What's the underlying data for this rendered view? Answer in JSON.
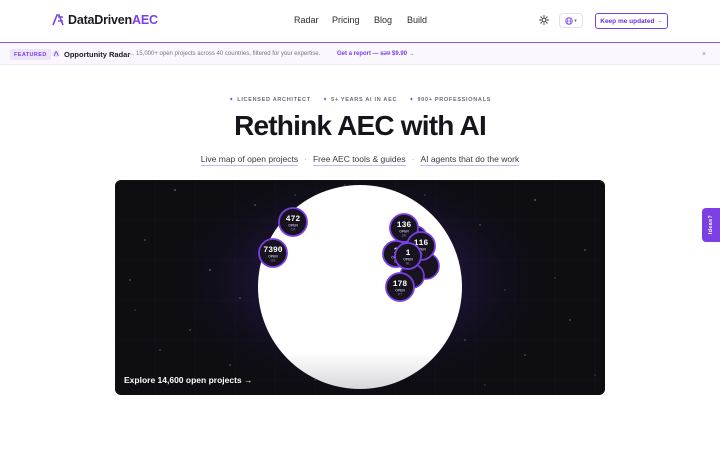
{
  "header": {
    "logo_main": "DataDriven",
    "logo_accent": "AEC",
    "nav": [
      "Radar",
      "Pricing",
      "Blog",
      "Build"
    ],
    "cta_label": "Keep me updated →",
    "theme_icon": "sun-icon",
    "lang_icon": "globe-icon"
  },
  "banner": {
    "tag": "FEATURED",
    "title": "Opportunity Radar",
    "dash": "—",
    "description": "15,000+ open projects across 40 countries, filtered for your expertise.",
    "link_prefix": "Get a report — ",
    "link_old_price": "$29",
    "link_new_price": " $9.90 →",
    "close": "×"
  },
  "hero": {
    "badges": [
      "LICENSED ARCHITECT",
      "5+ YEARS AI IN AEC",
      "900+ PROFESSIONALS"
    ],
    "badge_bullet": "✦",
    "headline": "Rethink AEC with AI",
    "sub_items": [
      "Live map of open projects",
      "Free AEC tools & guides",
      "AI agents that do the work"
    ],
    "sub_sep": "·"
  },
  "map": {
    "explore_label": "Explore 14,600 open projects →",
    "open_label": "OPEN",
    "clusters": [
      {
        "count": "472",
        "code": "CA"
      },
      {
        "count": "7390",
        "code": "US"
      },
      {
        "count": "136",
        "code": "DE"
      },
      {
        "count": "116",
        "code": "PL"
      },
      {
        "count": "1",
        "code": "BE"
      },
      {
        "count": "1",
        "code": "NL"
      },
      {
        "count": "178",
        "code": "PT"
      }
    ]
  },
  "ideas_tab": "Ideas?",
  "colors": {
    "accent": "#7b3fe4",
    "dark": "#0d0d12"
  }
}
